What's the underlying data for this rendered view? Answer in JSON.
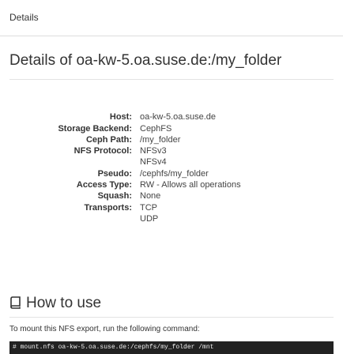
{
  "tabs": {
    "details_label": "Details"
  },
  "page_title": "Details of oa-kw-5.oa.suse.de:/my_folder",
  "properties": [
    {
      "label": "Host:",
      "values": [
        "oa-kw-5.oa.suse.de"
      ]
    },
    {
      "label": "Storage Backend:",
      "values": [
        "CephFS"
      ]
    },
    {
      "label": "Ceph Path:",
      "values": [
        "/my_folder"
      ]
    },
    {
      "label": "NFS Protocol:",
      "values": [
        "NFSv3",
        "NFSv4"
      ]
    },
    {
      "label": "Pseudo:",
      "values": [
        "/cephfs/my_folder"
      ]
    },
    {
      "label": "Access Type:",
      "values": [
        "RW - Allows all operations"
      ]
    },
    {
      "label": "Squash:",
      "values": [
        "None"
      ]
    },
    {
      "label": "Transports:",
      "values": [
        "TCP",
        "UDP"
      ]
    }
  ],
  "howto": {
    "title": "How to use",
    "icon": "book-icon"
  },
  "instruction": "To mount this NFS export, run the following command:",
  "command": "# mount.nfs oa-kw-5.oa.suse.de:/cephfs/my_folder /mnt"
}
